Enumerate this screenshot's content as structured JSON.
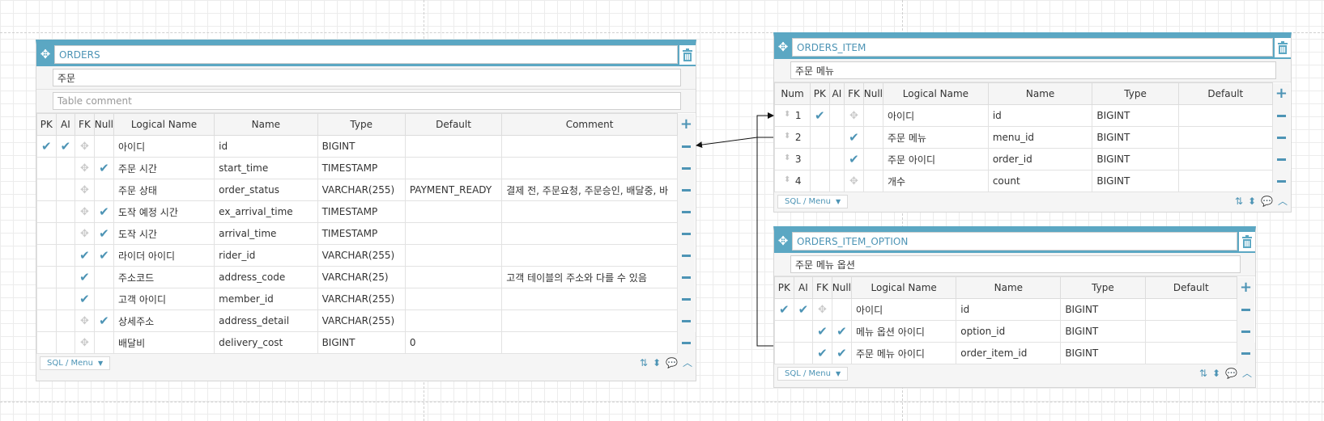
{
  "tables": {
    "orders": {
      "name": "ORDERS",
      "comment": "주문",
      "comment_placeholder": "Table comment",
      "headers": [
        "PK",
        "AI",
        "FK",
        "Null",
        "Logical Name",
        "Name",
        "Type",
        "Default",
        "Comment"
      ],
      "rows": [
        {
          "pk": true,
          "ai": true,
          "fk": false,
          "nn": false,
          "logical": "아이디",
          "name": "id",
          "type": "BIGINT",
          "def": "",
          "comment": ""
        },
        {
          "pk": false,
          "ai": false,
          "fk": false,
          "nn": true,
          "logical": "주문 시간",
          "name": "start_time",
          "type": "TIMESTAMP",
          "def": "",
          "comment": ""
        },
        {
          "pk": false,
          "ai": false,
          "fk": false,
          "nn": false,
          "logical": "주문 상태",
          "name": "order_status",
          "type": "VARCHAR(255)",
          "def": "PAYMENT_READY",
          "comment": "결제 전, 주문요청, 주문승인, 배달중, 바"
        },
        {
          "pk": false,
          "ai": false,
          "fk": false,
          "nn": true,
          "logical": "도작 예정 시간",
          "name": "ex_arrival_time",
          "type": "TIMESTAMP",
          "def": "",
          "comment": ""
        },
        {
          "pk": false,
          "ai": false,
          "fk": false,
          "nn": true,
          "logical": "도작 시간",
          "name": "arrival_time",
          "type": "TIMESTAMP",
          "def": "",
          "comment": ""
        },
        {
          "pk": false,
          "ai": false,
          "fk": true,
          "nn": true,
          "logical": "라이더 아이디",
          "name": "rider_id",
          "type": "VARCHAR(255)",
          "def": "",
          "comment": ""
        },
        {
          "pk": false,
          "ai": false,
          "fk": true,
          "nn": false,
          "logical": "주소코드",
          "name": "address_code",
          "type": "VARCHAR(25)",
          "def": "",
          "comment": "고객 테이블의 주소와 다를 수 있음"
        },
        {
          "pk": false,
          "ai": false,
          "fk": true,
          "nn": false,
          "logical": "고객 아이디",
          "name": "member_id",
          "type": "VARCHAR(255)",
          "def": "",
          "comment": ""
        },
        {
          "pk": false,
          "ai": false,
          "fk": false,
          "nn": true,
          "logical": "상세주소",
          "name": "address_detail",
          "type": "VARCHAR(255)",
          "def": "",
          "comment": ""
        },
        {
          "pk": false,
          "ai": false,
          "fk": false,
          "nn": false,
          "logical": "배달비",
          "name": "delivery_cost",
          "type": "BIGINT",
          "def": "0",
          "comment": ""
        }
      ]
    },
    "orders_item": {
      "name": "ORDERS_ITEM",
      "comment": "주문 메뉴",
      "headers": [
        "Num",
        "PK",
        "AI",
        "FK",
        "Null",
        "Logical Name",
        "Name",
        "Type",
        "Default"
      ],
      "rows": [
        {
          "num": "1",
          "pk": true,
          "ai": false,
          "fk": false,
          "nn": false,
          "logical": "아이디",
          "name": "id",
          "type": "BIGINT",
          "def": ""
        },
        {
          "num": "2",
          "pk": false,
          "ai": false,
          "fk": true,
          "nn": false,
          "logical": "주문 메뉴",
          "name": "menu_id",
          "type": "BIGINT",
          "def": ""
        },
        {
          "num": "3",
          "pk": false,
          "ai": false,
          "fk": true,
          "nn": false,
          "logical": "주문 아이디",
          "name": "order_id",
          "type": "BIGINT",
          "def": ""
        },
        {
          "num": "4",
          "pk": false,
          "ai": false,
          "fk": false,
          "nn": false,
          "logical": "개수",
          "name": "count",
          "type": "BIGINT",
          "def": ""
        }
      ]
    },
    "orders_item_option": {
      "name": "ORDERS_ITEM_OPTION",
      "comment": "주문 메뉴 옵션",
      "headers": [
        "PK",
        "AI",
        "FK",
        "Null",
        "Logical Name",
        "Name",
        "Type",
        "Default"
      ],
      "rows": [
        {
          "pk": true,
          "ai": true,
          "fk": false,
          "nn": false,
          "logical": "아이디",
          "name": "id",
          "type": "BIGINT",
          "def": ""
        },
        {
          "pk": false,
          "ai": false,
          "fk": true,
          "nn": true,
          "logical": "메뉴 옵션 아이디",
          "name": "option_id",
          "type": "BIGINT",
          "def": ""
        },
        {
          "pk": false,
          "ai": false,
          "fk": true,
          "nn": true,
          "logical": "주문 메뉴 아이디",
          "name": "order_item_id",
          "type": "BIGINT",
          "def": ""
        }
      ]
    }
  },
  "footer": {
    "sql_menu_label": "SQL / Menu"
  },
  "icons": {
    "move": "move-icon",
    "trash": "trash-icon",
    "check": "check-icon",
    "fk_handle": "drag-handle-icon",
    "add": "plus-icon",
    "remove": "minus-icon",
    "sort_az": "sort-az-icon",
    "sort": "sort-icon",
    "comment": "comment-icon",
    "collapse": "chevron-up-icon"
  },
  "colors": {
    "accent": "#5ba7c3",
    "icon": "#4d94b5",
    "grid": "#ececec"
  }
}
